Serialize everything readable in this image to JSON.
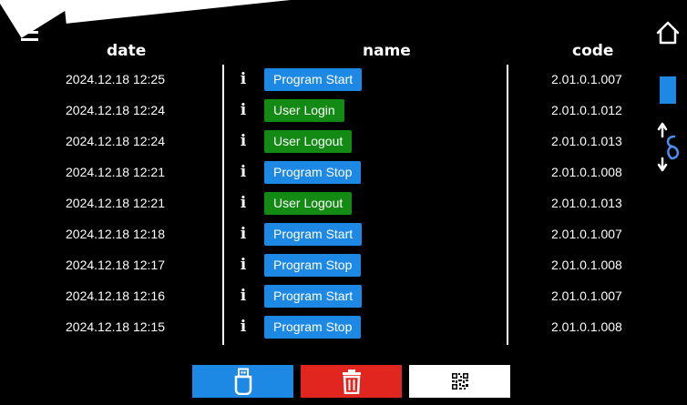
{
  "header": {
    "date": "date",
    "name": "name",
    "code": "code"
  },
  "colors": {
    "blue": "#1e88e5",
    "green": "#138a13",
    "red": "#e12620",
    "background": "#000000"
  },
  "rows": [
    {
      "date": "2024.12.18  12:25",
      "event": "Program Start",
      "event_color": "blue",
      "code": "2.01.0.1.007"
    },
    {
      "date": "2024.12.18  12:24",
      "event": "User Login",
      "event_color": "green",
      "code": "2.01.0.1.012"
    },
    {
      "date": "2024.12.18  12:24",
      "event": "User Logout",
      "event_color": "green",
      "code": "2.01.0.1.013"
    },
    {
      "date": "2024.12.18  12:21",
      "event": "Program Stop",
      "event_color": "blue",
      "code": "2.01.0.1.008"
    },
    {
      "date": "2024.12.18  12:21",
      "event": "User Logout",
      "event_color": "green",
      "code": "2.01.0.1.013"
    },
    {
      "date": "2024.12.18  12:18",
      "event": "Program Start",
      "event_color": "blue",
      "code": "2.01.0.1.007"
    },
    {
      "date": "2024.12.18  12:17",
      "event": "Program Stop",
      "event_color": "blue",
      "code": "2.01.0.1.008"
    },
    {
      "date": "2024.12.18  12:16",
      "event": "Program Start",
      "event_color": "blue",
      "code": "2.01.0.1.007"
    },
    {
      "date": "2024.12.18  12:15",
      "event": "Program Stop",
      "event_color": "blue",
      "code": "2.01.0.1.008"
    }
  ],
  "icons": {
    "menu": "hamburger-menu-icon",
    "home": "home-icon",
    "scroll": "scroll-up-down-icon",
    "info": "info-icon",
    "usb": "usb-drive-icon",
    "delete": "trash-icon",
    "qr": "qr-code-icon"
  }
}
